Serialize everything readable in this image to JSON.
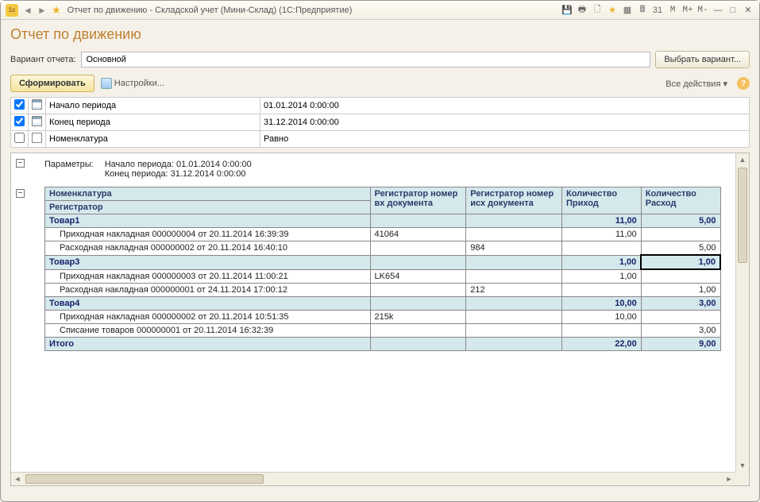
{
  "window": {
    "title": "Отчет по движению - Складской учет (Мини-Склад)  (1С:Предприятие)"
  },
  "header": {
    "page_title": "Отчет по движению",
    "variant_label": "Вариант отчета:",
    "variant_value": "Основной",
    "select_variant_btn": "Выбрать вариант...",
    "form_btn": "Сформировать",
    "settings_link": "Настройки...",
    "all_actions": "Все действия ▾"
  },
  "params": [
    {
      "checked": true,
      "icon": "cal",
      "label": "Начало периода",
      "value": "01.01.2014 0:00:00"
    },
    {
      "checked": true,
      "icon": "cal",
      "label": "Конец периода",
      "value": "31.12.2014 0:00:00"
    },
    {
      "checked": false,
      "icon": "list",
      "label": "Номенклатура",
      "value": "Равно"
    }
  ],
  "report": {
    "param_title": "Параметры:",
    "param_line1": "Начало периода: 01.01.2014 0:00:00",
    "param_line2": "Конец периода: 31.12.2014 0:00:00",
    "columns": {
      "nomenclature": "Номенклатура",
      "registrar": "Регистратор",
      "reg_in": "Регистратор номер вх документа",
      "reg_out": "Регистратор номер исх документа",
      "qty_in": "Количество Приход",
      "qty_out": "Количество Расход"
    },
    "groups": [
      {
        "name": "Товар1",
        "qty_in": "11,00",
        "qty_out": "5,00",
        "rows": [
          {
            "reg": "Приходная накладная 000000004 от 20.11.2014 16:39:39",
            "in_no": "41064",
            "out_no": "",
            "qi": "11,00",
            "qo": ""
          },
          {
            "reg": "Расходная накладная 000000002 от 20.11.2014 16:40:10",
            "in_no": "",
            "out_no": "984",
            "qi": "",
            "qo": "5,00"
          }
        ]
      },
      {
        "name": "Товар3",
        "qty_in": "1,00",
        "qty_out": "1,00",
        "highlight_out": true,
        "rows": [
          {
            "reg": "Приходная накладная 000000003 от 20.11.2014 11:00:21",
            "in_no": "LK654",
            "out_no": "",
            "qi": "1,00",
            "qo": ""
          },
          {
            "reg": "Расходная накладная 000000001 от 24.11.2014 17:00:12",
            "in_no": "",
            "out_no": "212",
            "qi": "",
            "qo": "1,00"
          }
        ]
      },
      {
        "name": "Товар4",
        "qty_in": "10,00",
        "qty_out": "3,00",
        "rows": [
          {
            "reg": "Приходная накладная 000000002 от 20.11.2014 10:51:35",
            "in_no": "215k",
            "out_no": "",
            "qi": "10,00",
            "qo": ""
          },
          {
            "reg": "Списание товаров 000000001 от 20.11.2014 16:32:39",
            "in_no": "",
            "out_no": "",
            "qi": "",
            "qo": "3,00"
          }
        ]
      }
    ],
    "total": {
      "label": "Итого",
      "qty_in": "22,00",
      "qty_out": "9,00"
    }
  }
}
